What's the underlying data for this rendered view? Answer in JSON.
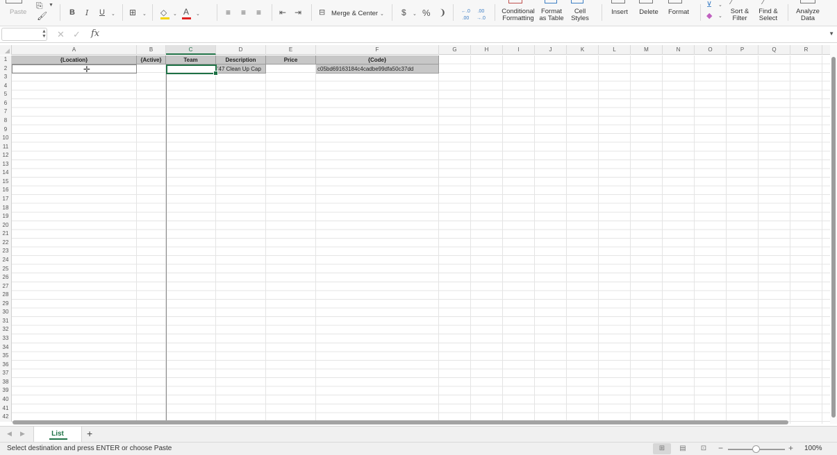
{
  "ribbon": {
    "paste_label": "Paste",
    "bold": "B",
    "italic": "I",
    "underline": "U",
    "merge_center": "Merge & Center",
    "currency": "$",
    "percent": "%",
    "comma": "❩",
    "decrease_decimal": "←.0",
    "decrease_decimal_sub": ".00",
    "increase_decimal": ".00",
    "increase_decimal_sub": "→.0",
    "conditional_formatting": [
      "Conditional",
      "Formatting"
    ],
    "format_as_table": [
      "Format",
      "as Table"
    ],
    "cell_styles": [
      "Cell",
      "Styles"
    ],
    "insert": "Insert",
    "delete": "Delete",
    "format": "Format",
    "sort_filter": [
      "Sort &",
      "Filter"
    ],
    "find_select": [
      "Find &",
      "Select"
    ],
    "analyze_data": [
      "Analyze",
      "Data"
    ],
    "font_color": "#e02020",
    "fill_color": "#f5d400"
  },
  "formula_bar": {
    "name_box_value": "",
    "formula_value": "",
    "fx_label": "fx"
  },
  "sheet": {
    "columns": [
      "A",
      "B",
      "C",
      "D",
      "E",
      "F",
      "G",
      "H",
      "I",
      "J",
      "K",
      "L",
      "M",
      "N",
      "O",
      "P",
      "Q",
      "R"
    ],
    "selected_column": "C",
    "rows": [
      "1",
      "2",
      "3",
      "4",
      "5",
      "6",
      "7",
      "8",
      "9",
      "10",
      "11",
      "12",
      "13",
      "14",
      "15",
      "16",
      "17",
      "18",
      "19",
      "20",
      "21",
      "22",
      "23",
      "24",
      "25",
      "26",
      "27",
      "28",
      "29",
      "30",
      "31",
      "32",
      "33",
      "34",
      "35",
      "36",
      "37",
      "38",
      "39",
      "40",
      "41",
      "42"
    ],
    "header_row": {
      "A": "{Location}",
      "B": "{Active}",
      "C": "Team",
      "D": "Description",
      "E": "Price",
      "F": "{Code}"
    },
    "row2": {
      "D": "'47 Clean Up Cap",
      "F": "c05bd69163184c4cadbe99dfa50c37dd"
    },
    "accent_color": "#1e7145"
  },
  "tabs": {
    "active_tab": "List",
    "add_label": "+"
  },
  "status": {
    "message": "Select destination and press ENTER or choose Paste",
    "zoom": "100%",
    "zoom_fraction": 0.5
  }
}
